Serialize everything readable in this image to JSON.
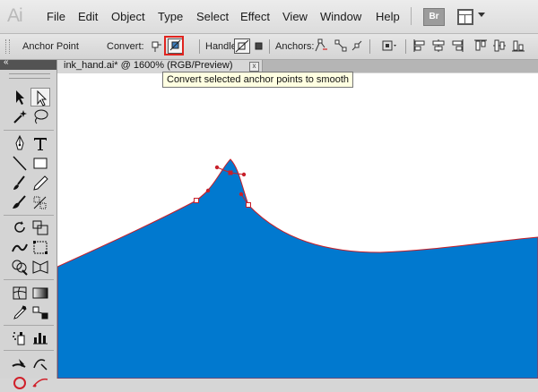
{
  "app": {
    "logo": "Ai"
  },
  "menu": [
    "File",
    "Edit",
    "Object",
    "Type",
    "Select",
    "Effect",
    "View",
    "Window",
    "Help"
  ],
  "bridge_button": "Br",
  "control_bar": {
    "mode_label": "Anchor Point",
    "convert_label": "Convert:",
    "handles_label": "Handles:",
    "anchors_label": "Anchors:"
  },
  "tooltip": "Convert selected anchor points to smooth",
  "document": {
    "tab_title": "ink_hand.ai* @ 1600% (RGB/Preview)",
    "close_glyph": "x"
  },
  "colors": {
    "fill": "#0179cf",
    "path_stroke": "#c8202a",
    "highlight": "#e0241f"
  }
}
